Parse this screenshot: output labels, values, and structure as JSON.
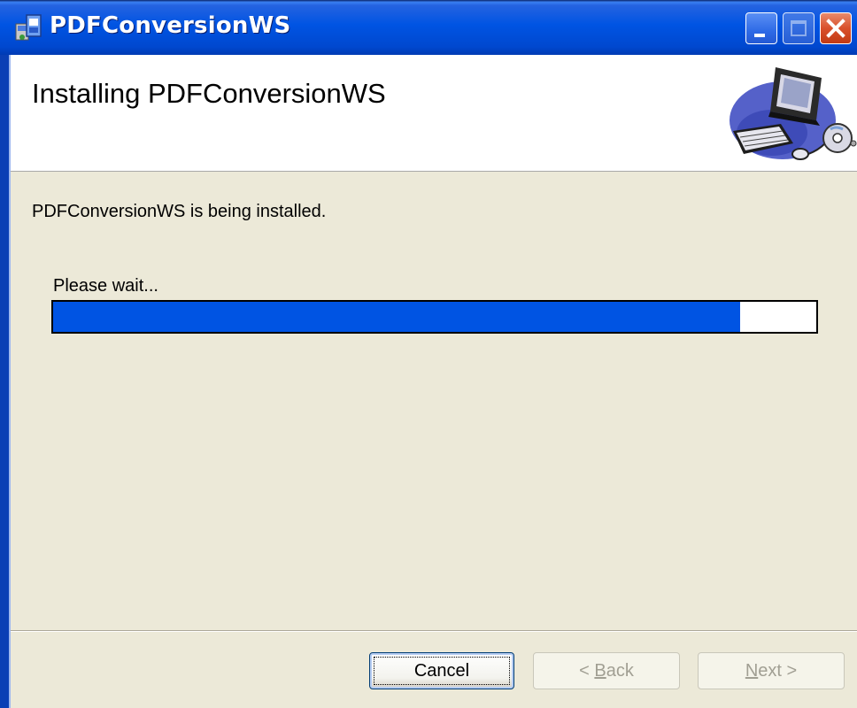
{
  "window": {
    "title": "PDFConversionWS",
    "controls": {
      "minimize_icon": "minimize-icon",
      "maximize_icon": "maximize-icon",
      "close_icon": "close-icon"
    }
  },
  "header": {
    "title": "Installing PDFConversionWS",
    "art_icon": "computer-install-icon"
  },
  "body": {
    "status": "PDFConversionWS is being installed.",
    "wait_label": "Please wait...",
    "progress_fraction": 0.9
  },
  "footer": {
    "cancel_label": "Cancel",
    "back_prefix": "< ",
    "back_mnemonic": "B",
    "back_rest": "ack",
    "next_mnemonic": "N",
    "next_rest": "ext >"
  },
  "colors": {
    "titlebar": "#0054e3",
    "progress_fill": "#0054e3",
    "dialog_bg": "#ece9d8"
  }
}
